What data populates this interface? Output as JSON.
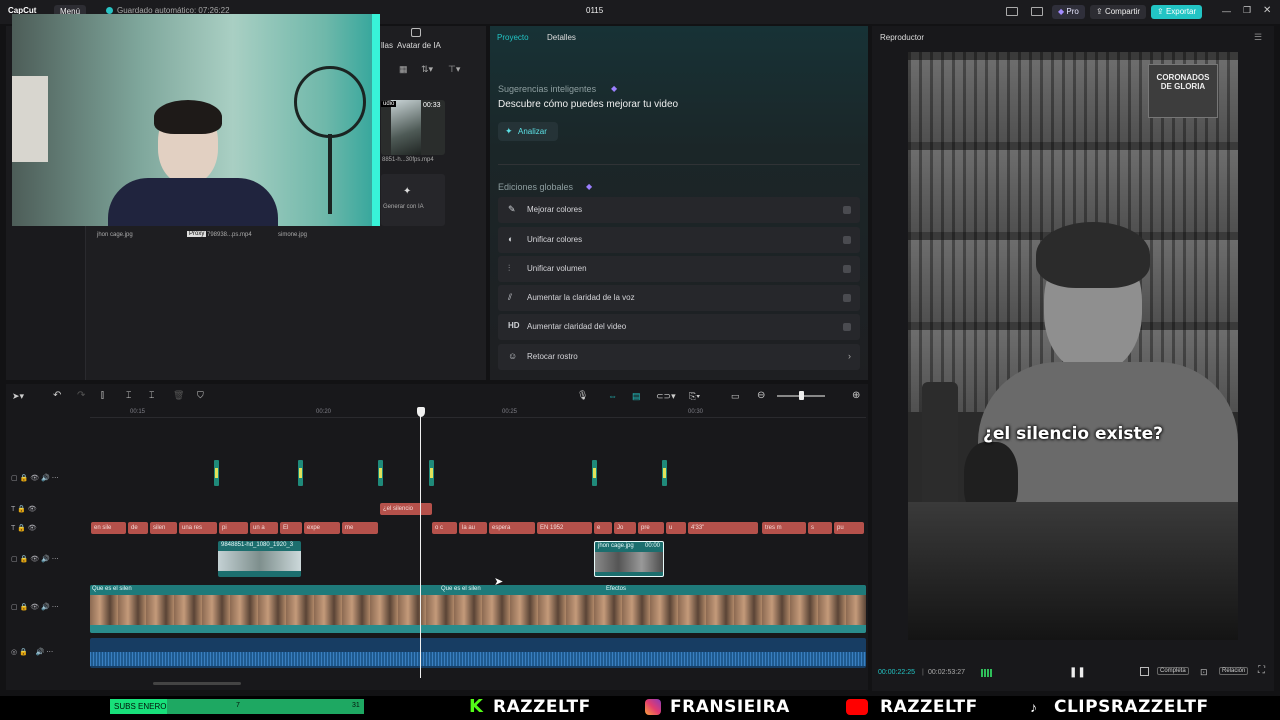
{
  "app": {
    "logo": "CapCut",
    "menu": "Menú",
    "autosave": "Guardado automático: 07:26:22",
    "project_title": "0115",
    "pro": "Pro",
    "share": "Compartir",
    "export": "Exportar"
  },
  "media": {
    "tab_partial": "llas",
    "tab_ai_avatar": "Avatar de IA",
    "audio_badge": "udio",
    "duration": "00:33",
    "file1": "8851-h...30fps.mp4",
    "generate_ai": "Generar con IA",
    "thumb_labels": [
      "jhon cage.jpg",
      "798938...ps.mp4",
      "simone.jpg"
    ],
    "proxy": "Proxy"
  },
  "project_panel": {
    "tabs": [
      "Proyecto",
      "Detalles"
    ],
    "smart_title": "Sugerencias inteligentes",
    "smart_desc": "Descubre cómo puedes mejorar tu video",
    "analyze": "Analizar",
    "global_title": "Ediciones globales",
    "items": [
      {
        "label": "Mejorar colores",
        "icon": "✎"
      },
      {
        "label": "Unificar colores",
        "icon": "◐"
      },
      {
        "label": "Unificar volumen",
        "icon": "⫶"
      },
      {
        "label": "Aumentar la claridad de la voz",
        "icon": "⫽"
      },
      {
        "label": "Aumentar claridad del video",
        "icon": "HD"
      },
      {
        "label": "Retocar rostro",
        "icon": "☺"
      }
    ]
  },
  "player": {
    "title": "Reproductor",
    "caption": "¿el silencio existe?",
    "current_time": "00:00:22:25",
    "total_time": "00:02:53:27",
    "full_label": "Completa",
    "ratio_label": "Relación"
  },
  "timeline": {
    "ruler": [
      "00:15",
      "00:20",
      "00:25",
      "00:30"
    ],
    "caption_clip": "¿el silencio",
    "text_clips": [
      "en sile",
      "de",
      "silen",
      "una res",
      "pi",
      "un a",
      "El",
      "expe",
      "me",
      "o c",
      "la au",
      "espera",
      "EN 1952",
      "e",
      "Jo",
      "pre",
      "u",
      "4'33\"",
      "tres m",
      "s",
      "pu"
    ],
    "video_clip1": "9848851-hd_1080_1920_3",
    "video_clip2": "jhon cage.jpg",
    "video_clip2_time": "00:00",
    "main_track_label": "Que es el silen",
    "effects": "Efectos"
  },
  "overlay": {
    "subs_label": "SUBS ENERO",
    "subs_current": "7",
    "subs_goal": "31",
    "subs_progress": 0.226,
    "socials": [
      "RAZZELTF",
      "FRANSIEIRA",
      "RAZZELTF",
      "CLIPSRAZZELTF"
    ]
  }
}
